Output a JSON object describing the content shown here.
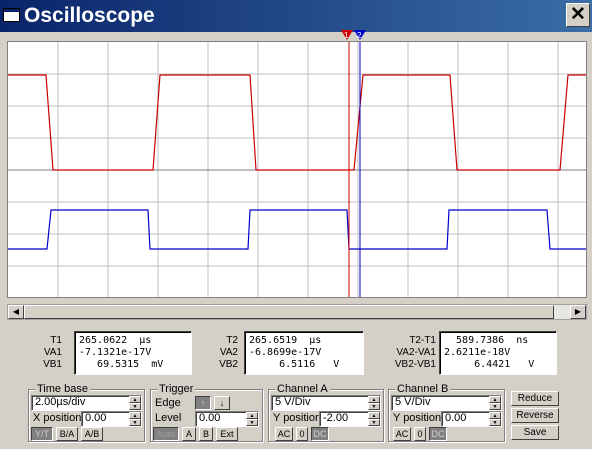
{
  "window": {
    "title": "Oscilloscope",
    "close_label": "✕"
  },
  "icons": {
    "app": "oscilloscope-window-icon",
    "close": "close-icon",
    "cursor1": "cursor-1-marker-icon",
    "cursor2": "cursor-2-marker-icon"
  },
  "colors": {
    "channel_a": "#cc0000",
    "channel_b": "#0000cc",
    "grid": "#c0c0c0",
    "background": "#ffffff"
  },
  "cursors": {
    "c1_label": "1",
    "c2_label": "2"
  },
  "readout": {
    "t1_label": "T1",
    "t1": "265.0622  µs",
    "va1_label": "VA1",
    "va1": "-7.1321e-17V",
    "vb1_label": "VB1",
    "vb1": "   69.5315  mV",
    "t2_label": "T2",
    "t2": "265.6519  µs",
    "va2_label": "VA2",
    "va2": "-6.8699e-17V",
    "vb2_label": "VB2",
    "vb2": "     6.5116   V",
    "dt_label": "T2-T1",
    "dt": "  589.7386  ns",
    "dva_label": "VA2-VA1",
    "dva": "2.6211e-18V",
    "dvb_label": "VB2-VB1",
    "dvb": "     6.4421   V"
  },
  "timebase": {
    "title": "Time base",
    "scale": "2.00µs/div",
    "xpos_label": "X position",
    "xpos": "0.00",
    "btn_yt": "Y/T",
    "btn_ba": "B/A",
    "btn_ab": "A/B"
  },
  "trigger": {
    "title": "Trigger",
    "edge_label": "Edge",
    "level_label": "Level",
    "level": "0.00",
    "btn_auto": "Auto",
    "btn_a": "A",
    "btn_b": "B",
    "btn_ext": "Ext"
  },
  "channel_a": {
    "title": "Channel A",
    "scale": "5 V/Div",
    "ypos_label": "Y position",
    "ypos": "-2.00",
    "btn_ac": "AC",
    "btn_0": "0",
    "btn_dc": "DC"
  },
  "channel_b": {
    "title": "Channel B",
    "scale": "5 V/Div",
    "ypos_label": "Y position",
    "ypos": "0.00",
    "btn_ac": "AC",
    "btn_0": "0",
    "btn_dc": "DC"
  },
  "actions": {
    "reduce": "Reduce",
    "reverse": "Reverse",
    "save": "Save"
  }
}
